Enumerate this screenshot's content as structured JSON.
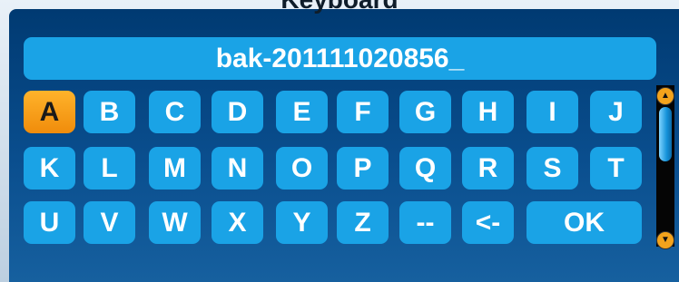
{
  "title": "Keyboard",
  "input_value": "bak-201111020856_",
  "rows": [
    [
      "A",
      "B",
      "C",
      "D",
      "E",
      "F",
      "G",
      "H",
      "I",
      "J"
    ],
    [
      "K",
      "L",
      "M",
      "N",
      "O",
      "P",
      "Q",
      "R",
      "S",
      "T"
    ],
    [
      "U",
      "V",
      "W",
      "X",
      "Y",
      "Z",
      "--",
      "<-",
      "OK"
    ]
  ],
  "selected_key": "A",
  "colors": {
    "key": "#1aa3e6",
    "selected": "#f5a01f",
    "panel": "#0a4e8e"
  },
  "scroll_icons": {
    "up": "arrow-up-icon",
    "down": "arrow-down-icon"
  }
}
